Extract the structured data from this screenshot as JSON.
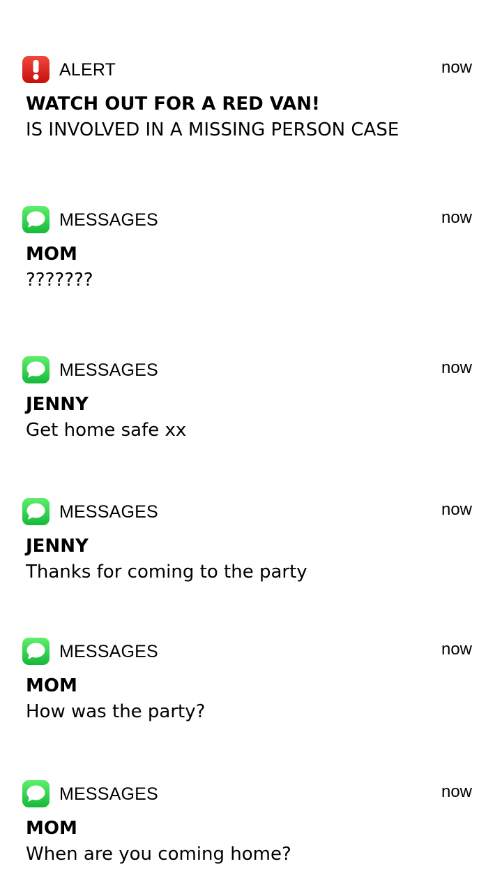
{
  "notifications": [
    {
      "app": "ALERT",
      "icon": "alert-icon",
      "time": "now",
      "title": "WATCH OUT FOR A RED VAN!",
      "body": "IS INVOLVED IN A MISSING PERSON CASE"
    },
    {
      "app": "MESSAGES",
      "icon": "messages-icon",
      "time": "now",
      "title": "MOM",
      "body": "???????"
    },
    {
      "app": "MESSAGES",
      "icon": "messages-icon",
      "time": "now",
      "title": "JENNY",
      "body": "Get home safe xx"
    },
    {
      "app": "MESSAGES",
      "icon": "messages-icon",
      "time": "now",
      "title": "JENNY",
      "body": "Thanks for coming to the party"
    },
    {
      "app": "MESSAGES",
      "icon": "messages-icon",
      "time": "now",
      "title": "MOM",
      "body": "How was the party?"
    },
    {
      "app": "MESSAGES",
      "icon": "messages-icon",
      "time": "now",
      "title": "MOM",
      "body": "When are you coming home?"
    }
  ],
  "colors": {
    "alert_red": "#e21d17",
    "messages_green": "#2fcc4c"
  }
}
